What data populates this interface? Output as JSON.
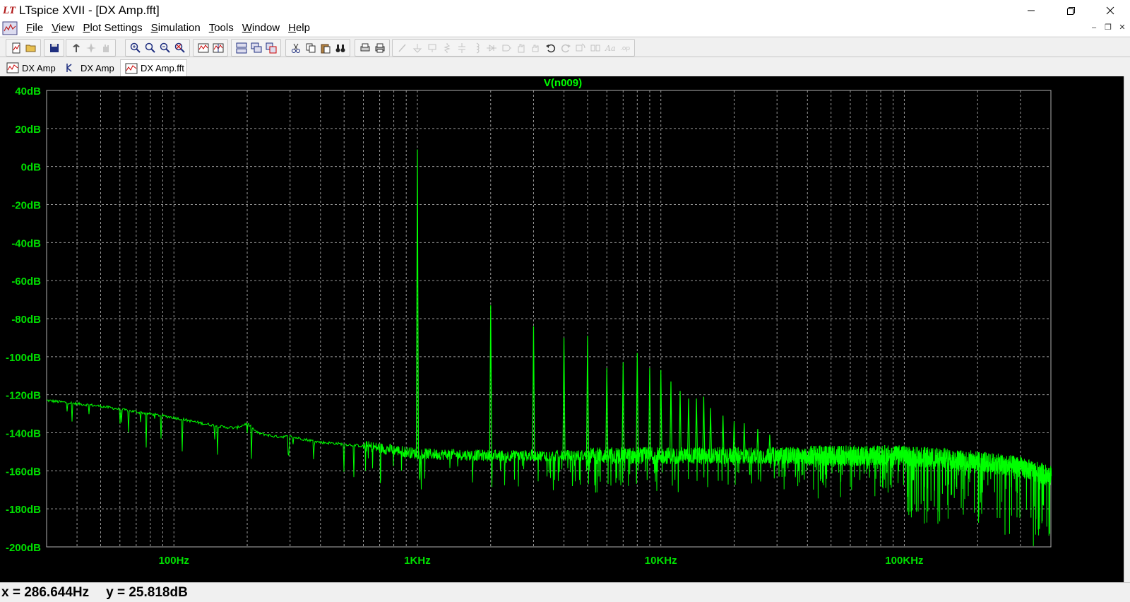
{
  "window": {
    "title": "LTspice XVII - [DX Amp.fft]",
    "controls": [
      "minimize-icon",
      "maximize-icon",
      "close-icon"
    ]
  },
  "menu": {
    "items": [
      {
        "label": "File",
        "underline": "F",
        "rest": "ile"
      },
      {
        "label": "View",
        "underline": "V",
        "rest": "iew"
      },
      {
        "label": "Plot Settings",
        "underline": "P",
        "rest": "lot Settings"
      },
      {
        "label": "Simulation",
        "underline": "S",
        "rest": "imulation"
      },
      {
        "label": "Tools",
        "underline": "T",
        "rest": "ools"
      },
      {
        "label": "Window",
        "underline": "W",
        "rest": "indow"
      },
      {
        "label": "Help",
        "underline": "H",
        "rest": "elp"
      }
    ]
  },
  "tabs": [
    {
      "label": "DX Amp",
      "icon": "waveform-icon",
      "active": false
    },
    {
      "label": "DX Amp",
      "icon": "schematic-icon",
      "active": false
    },
    {
      "label": "DX Amp.fft",
      "icon": "waveform-icon",
      "active": true
    }
  ],
  "plot": {
    "trace_label": "V(n009)",
    "trace_color": "#00ff00",
    "background": "#000000",
    "grid_color": "#9a9a9a",
    "axis_label_color": "#00e000"
  },
  "status": {
    "x_readout": "x = 286.644Hz",
    "y_readout": "y = 25.818dB"
  },
  "chart_data": {
    "type": "line",
    "title": "V(n009)",
    "xscale": "log",
    "xlim": [
      30,
      400000
    ],
    "ylim": [
      -200,
      40
    ],
    "xticks": [
      {
        "value": 100,
        "label": "100Hz"
      },
      {
        "value": 1000,
        "label": "1KHz"
      },
      {
        "value": 10000,
        "label": "10KHz"
      },
      {
        "value": 100000,
        "label": "100KHz"
      }
    ],
    "yticks": [
      {
        "value": 40,
        "label": "40dB"
      },
      {
        "value": 20,
        "label": "20dB"
      },
      {
        "value": 0,
        "label": "0dB"
      },
      {
        "value": -20,
        "label": "-20dB"
      },
      {
        "value": -40,
        "label": "-40dB"
      },
      {
        "value": -60,
        "label": "-60dB"
      },
      {
        "value": -80,
        "label": "-80dB"
      },
      {
        "value": -100,
        "label": "-100dB"
      },
      {
        "value": -120,
        "label": "-120dB"
      },
      {
        "value": -140,
        "label": "-140dB"
      },
      {
        "value": -160,
        "label": "-160dB"
      },
      {
        "value": -180,
        "label": "-180dB"
      },
      {
        "value": -200,
        "label": "-200dB"
      }
    ],
    "grid": true,
    "series": [
      {
        "name": "V(n009)",
        "noise_floor": [
          [
            30,
            -123
          ],
          [
            50,
            -126
          ],
          [
            70,
            -129
          ],
          [
            100,
            -132
          ],
          [
            130,
            -135
          ],
          [
            160,
            -137
          ],
          [
            180,
            -137.5
          ],
          [
            200,
            -135
          ],
          [
            220,
            -140
          ],
          [
            260,
            -142
          ],
          [
            300,
            -142
          ],
          [
            400,
            -145
          ],
          [
            500,
            -146
          ],
          [
            600,
            -147
          ],
          [
            800,
            -149
          ],
          [
            1000,
            -151
          ],
          [
            2000,
            -152
          ],
          [
            5000,
            -152
          ],
          [
            10000,
            -152
          ],
          [
            20000,
            -152
          ],
          [
            50000,
            -152
          ],
          [
            100000,
            -152
          ],
          [
            200000,
            -155
          ],
          [
            300000,
            -158
          ],
          [
            400000,
            -163
          ]
        ],
        "harmonics": [
          {
            "f": 1000,
            "db": 9
          },
          {
            "f": 2000,
            "db": -73
          },
          {
            "f": 3000,
            "db": -84
          },
          {
            "f": 4000,
            "db": -90
          },
          {
            "f": 5000,
            "db": -89
          },
          {
            "f": 6000,
            "db": -106
          },
          {
            "f": 7000,
            "db": -103
          },
          {
            "f": 8000,
            "db": -98
          },
          {
            "f": 9000,
            "db": -106
          },
          {
            "f": 10000,
            "db": -107
          },
          {
            "f": 11000,
            "db": -113
          },
          {
            "f": 12000,
            "db": -118
          },
          {
            "f": 13000,
            "db": -122
          },
          {
            "f": 14000,
            "db": -122
          },
          {
            "f": 15000,
            "db": -121
          },
          {
            "f": 16000,
            "db": -127
          },
          {
            "f": 18000,
            "db": -131
          },
          {
            "f": 20000,
            "db": -134
          },
          {
            "f": 22000,
            "db": -135
          },
          {
            "f": 25000,
            "db": -138
          },
          {
            "f": 28000,
            "db": -141
          }
        ]
      }
    ]
  }
}
